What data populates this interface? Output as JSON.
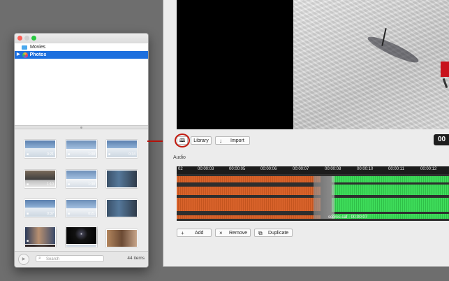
{
  "browser": {
    "sources": [
      {
        "label": "Movies",
        "icon": "folder-icon"
      },
      {
        "label": "Photos",
        "icon": "photos-icon",
        "selected": true
      }
    ],
    "thumbnails": [
      {
        "duration": "0:21"
      },
      {
        "duration": "1:08"
      },
      {
        "duration": "0:34"
      },
      {
        "duration": "1:10"
      },
      {
        "duration": "1:38"
      },
      {
        "duration": ""
      },
      {
        "duration": "0:37"
      },
      {
        "duration": "0:21"
      },
      {
        "duration": ""
      },
      {
        "duration": ""
      },
      {
        "duration": ""
      },
      {
        "duration": ""
      },
      {
        "duration": ""
      },
      {
        "duration": ""
      }
    ],
    "search_placeholder": "Search",
    "item_count": "44 items"
  },
  "toolbar": {
    "library_label": "Library",
    "import_label": "Import",
    "timecode": "00"
  },
  "audio": {
    "section_label": "Audio",
    "ruler": [
      "02",
      "00:00:03",
      "00:00:05",
      "00:00:06",
      "00:00:07",
      "00:00:08",
      "00:00:10",
      "00:00:11",
      "00:00:12"
    ],
    "clip_label": "scores.caf - 00:00:07",
    "colors": {
      "first_clip": "#d8622a",
      "second_clip": "#3edc5a"
    }
  },
  "actions": {
    "add_label": "Add",
    "remove_label": "Remove",
    "duplicate_label": "Duplicate"
  }
}
